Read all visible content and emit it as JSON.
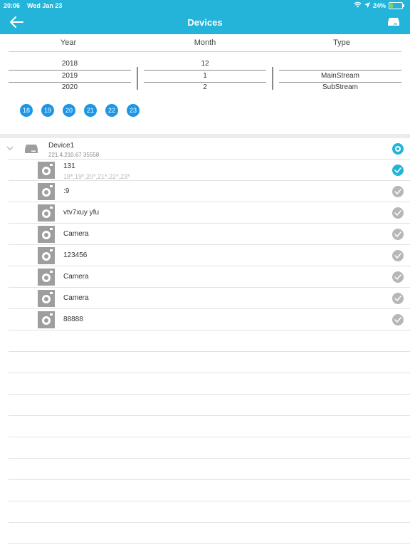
{
  "status_bar": {
    "time": "20:06",
    "date": "Wed Jan 23",
    "battery": "24%",
    "battery_level": 0.24,
    "icons": [
      "wifi-icon",
      "location-arrow-icon",
      "battery-charging-icon"
    ]
  },
  "header": {
    "title": "Devices",
    "back_icon": "arrow-left-icon",
    "action_icon": "dvr-icon",
    "color": "#25b4d9"
  },
  "picker": {
    "columns": [
      "Year",
      "Month",
      "Type"
    ],
    "year": [
      "2018",
      "2019",
      "2020"
    ],
    "month": [
      "12",
      "1",
      "2"
    ],
    "type": [
      "",
      "MainStream",
      "SubStream"
    ],
    "selected": {
      "year": "2019",
      "month": "1",
      "type": "MainStream"
    }
  },
  "days": [
    "18",
    "19",
    "20",
    "21",
    "22",
    "23"
  ],
  "device": {
    "name": "Device1",
    "address": "221.4.210.67  35558",
    "selected": true
  },
  "cameras": [
    {
      "name": "131",
      "sub": "18*,19*,20*,21*,22*,23*",
      "checked": true
    },
    {
      "name": ":9",
      "sub": "",
      "checked": false
    },
    {
      "name": "vtv7xuy yfu",
      "sub": "",
      "checked": false
    },
    {
      "name": "Camera",
      "sub": "",
      "checked": false
    },
    {
      "name": "123456",
      "sub": "",
      "checked": false
    },
    {
      "name": "Camera",
      "sub": "",
      "checked": false
    },
    {
      "name": "Camera",
      "sub": "",
      "checked": false
    },
    {
      "name": "88888",
      "sub": "",
      "checked": false
    }
  ],
  "colors": {
    "accent": "#25b4d9",
    "day_badge": "#1e96e6",
    "unchecked": "#b7b7b7"
  }
}
